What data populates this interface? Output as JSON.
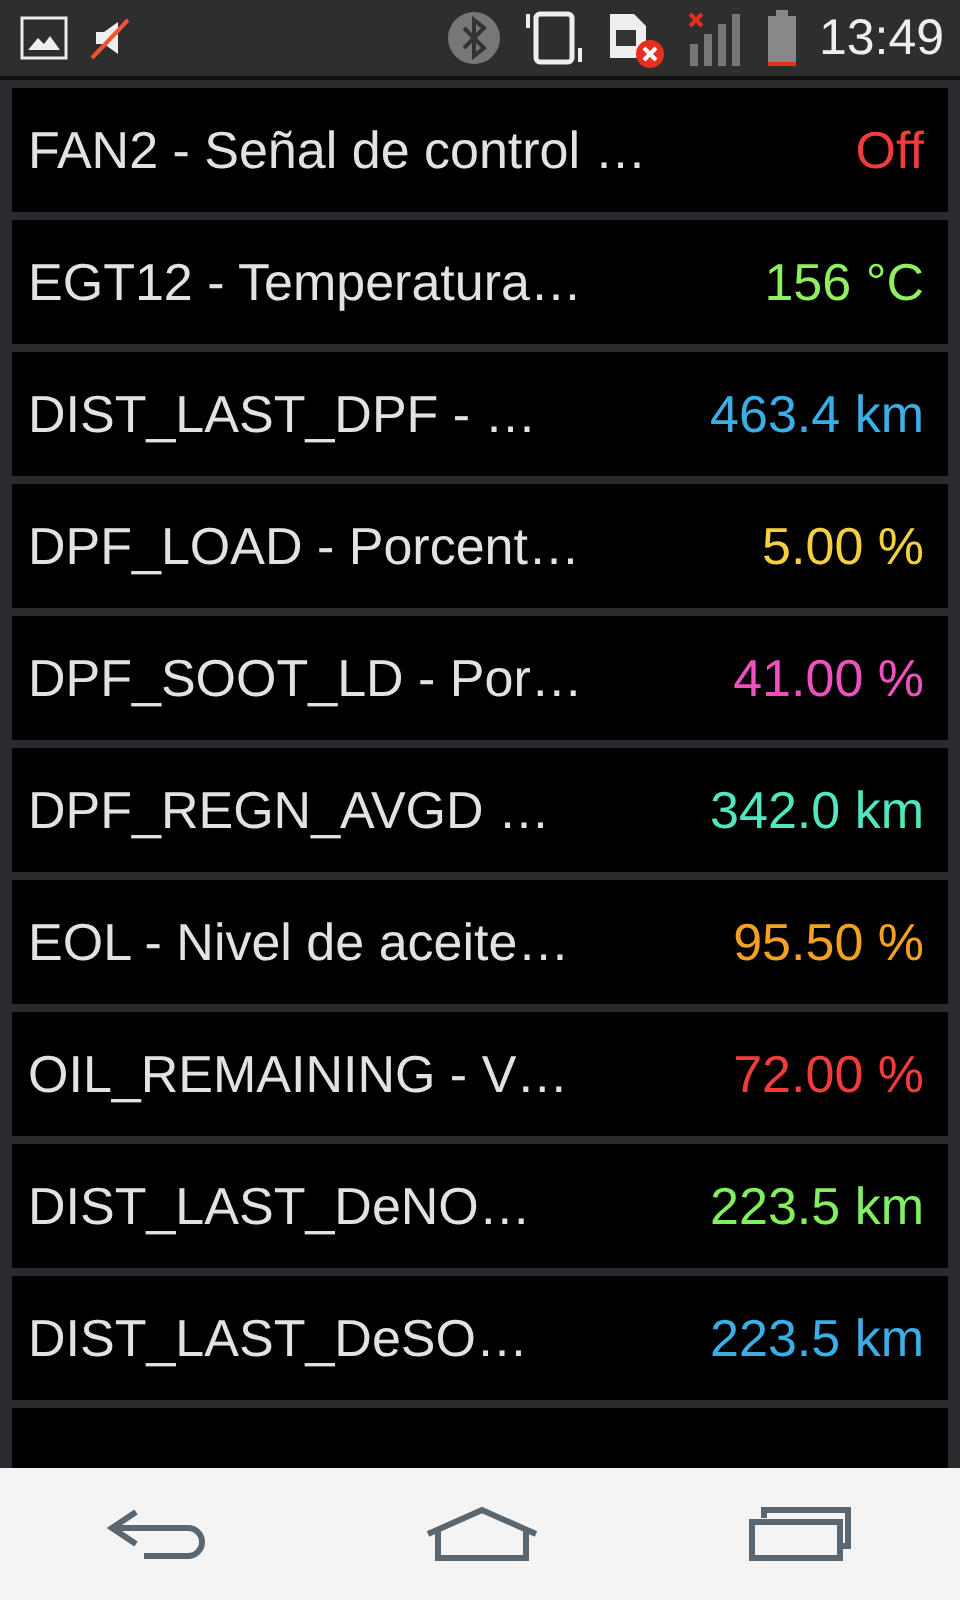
{
  "status_bar": {
    "time": "13:49"
  },
  "rows": [
    {
      "label": "FAN2 - Señal de control …",
      "value": "Off",
      "color": "#f23c3c"
    },
    {
      "label": "EGT12 - Temperatura…",
      "value": "156 °C",
      "color": "#8ef060"
    },
    {
      "label": "DIST_LAST_DPF - …",
      "value": "463.4 km",
      "color": "#3aaee6"
    },
    {
      "label": "DPF_LOAD - Porcent…",
      "value": "5.00 %",
      "color": "#f4d040"
    },
    {
      "label": "DPF_SOOT_LD - Por…",
      "value": "41.00 %",
      "color": "#ee50c0"
    },
    {
      "label": "DPF_REGN_AVGD …",
      "value": "342.0 km",
      "color": "#50e6c0"
    },
    {
      "label": "EOL - Nivel de aceite…",
      "value": "95.50 %",
      "color": "#f4a020"
    },
    {
      "label": "OIL_REMAINING - V…",
      "value": "72.00 %",
      "color": "#f23c3c"
    },
    {
      "label": "DIST_LAST_DeNO…",
      "value": "223.5 km",
      "color": "#80f060"
    },
    {
      "label": "DIST_LAST_DeSO…",
      "value": "223.5 km",
      "color": "#3aaee6"
    }
  ]
}
